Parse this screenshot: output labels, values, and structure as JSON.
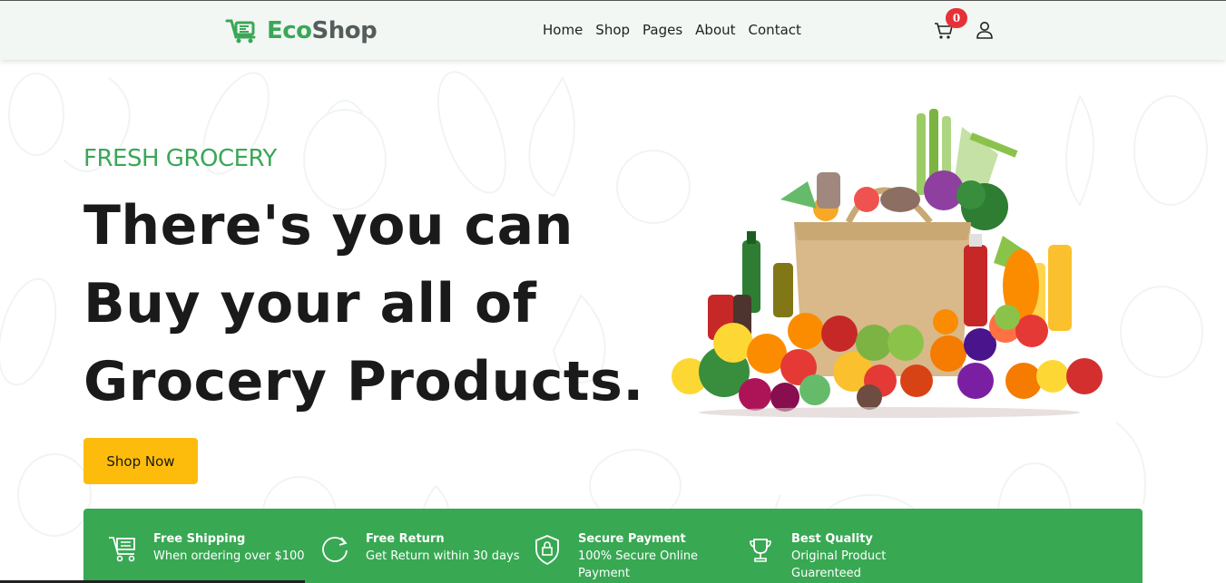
{
  "header": {
    "logo_eco": "Eco",
    "logo_shop": "Shop",
    "nav": [
      "Home",
      "Shop",
      "Pages",
      "About",
      "Contact"
    ],
    "cart_count": "0"
  },
  "hero": {
    "eyebrow": "FRESH GROCERY",
    "headline_lines": [
      "There's you can",
      "Buy your all of",
      "Grocery Products."
    ],
    "cta": "Shop Now"
  },
  "features": [
    {
      "icon": "shipping-cart-icon",
      "title": "Free Shipping",
      "desc": [
        "When ordering over $100"
      ]
    },
    {
      "icon": "return-arrow-icon",
      "title": "Free Return",
      "desc": [
        "Get Return within 30 days"
      ]
    },
    {
      "icon": "secure-lock-shield-icon",
      "title": "Secure Payment",
      "desc": [
        "100% Secure Online",
        "Payment"
      ]
    },
    {
      "icon": "trophy-icon",
      "title": "Best Quality",
      "desc": [
        "Original Product",
        "Guarenteed"
      ]
    }
  ],
  "colors": {
    "brand_green": "#3aa757",
    "cta_yellow": "#fdbc0c",
    "badge_red": "#e53239",
    "header_bg": "#f2f7f3"
  }
}
